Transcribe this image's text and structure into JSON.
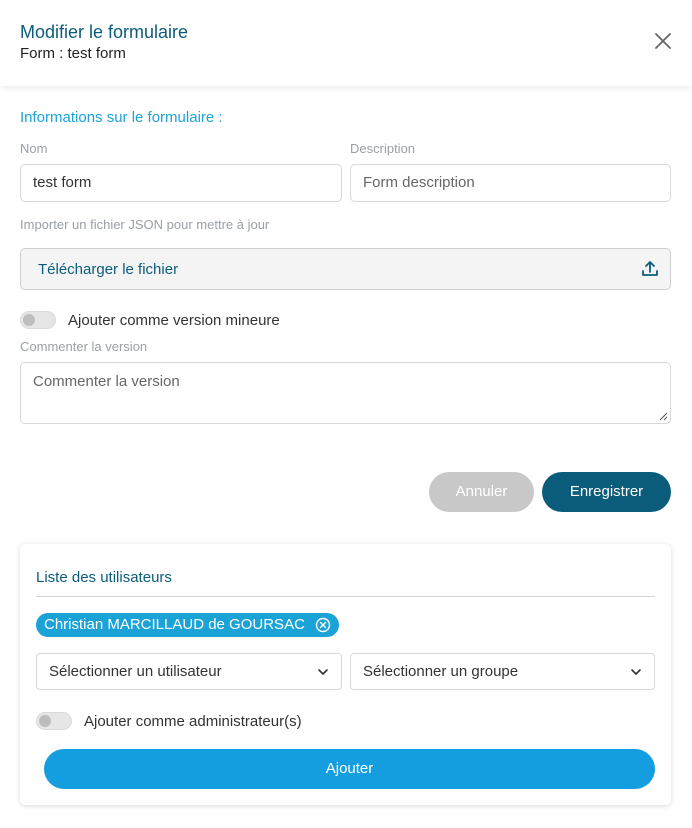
{
  "dialog": {
    "title": "Modifier le formulaire",
    "subtitle": "Form : test form"
  },
  "form_info": {
    "section_title": "Informations sur le formulaire :",
    "name_label": "Nom",
    "name_value": "test form",
    "description_label": "Description",
    "description_placeholder": "Form description",
    "import_label": "Importer un fichier JSON pour mettre à jour",
    "upload_label": "Télécharger le fichier",
    "minor_version_label": "Ajouter comme version mineure",
    "minor_version_enabled": false,
    "comment_label": "Commenter la version",
    "comment_placeholder": "Commenter la version"
  },
  "actions": {
    "cancel_label": "Annuler",
    "save_label": "Enregistrer"
  },
  "users": {
    "title": "Liste des utilisateurs",
    "selected_users": [
      "Christian MARCILLAUD de GOURSAC"
    ],
    "user_select_placeholder": "Sélectionner un utilisateur",
    "group_select_placeholder": "Sélectionner un groupe",
    "admin_label": "Ajouter comme administrateur(s)",
    "admin_enabled": false,
    "add_label": "Ajouter"
  },
  "colors": {
    "primary": "#0b5c7a",
    "accent": "#1ba3d8",
    "add_button": "#149ee0",
    "disabled": "#c8c8c8"
  },
  "icons": [
    "close-icon",
    "upload-icon",
    "chip-remove-icon",
    "chevron-down-icon",
    "resize-handle-icon"
  ]
}
